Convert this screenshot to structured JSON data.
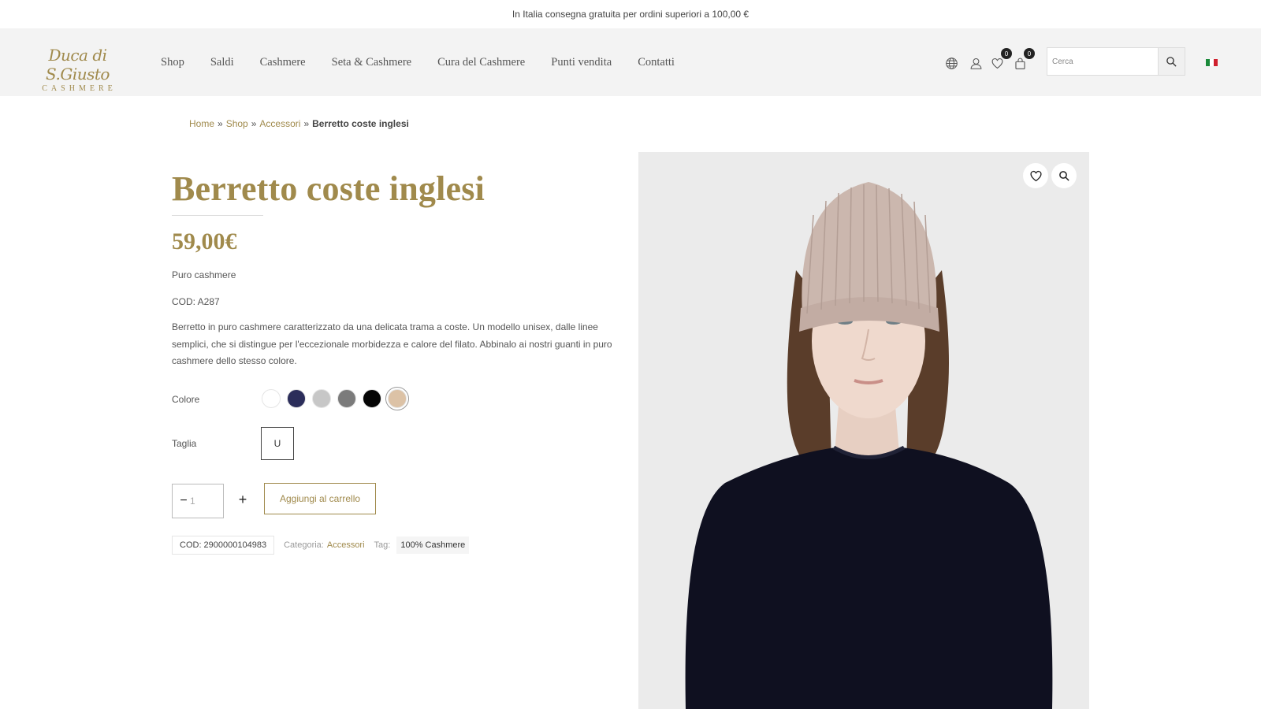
{
  "topbar": {
    "text": "In Italia consegna gratuita per ordini superiori a 100,00 €"
  },
  "header": {
    "logo": {
      "script": "Duca di S.Giusto",
      "sub": "CASHMERE"
    },
    "nav": [
      "Shop",
      "Saldi",
      "Cashmere",
      "Seta & Cashmere",
      "Cura del Cashmere",
      "Punti vendita",
      "Contatti"
    ],
    "wishlist_count": "0",
    "cart_count": "0",
    "search": {
      "placeholder": "Cerca"
    },
    "language_flag": "italian-flag"
  },
  "breadcrumb": {
    "home": "Home",
    "shop": "Shop",
    "category": "Accessori",
    "sep": "»",
    "current": "Berretto coste inglesi"
  },
  "product": {
    "title": "Berretto coste inglesi",
    "price": "59,00€",
    "material": "Puro cashmere",
    "code": "COD: A287",
    "description": "Berretto in puro cashmere caratterizzato da una delicata trama a coste. Un modello unisex, dalle linee semplici, che si distingue per l'eccezionale morbidezza e calore del filato. Abbinalo ai nostri guanti in puro cashmere dello stesso colore.",
    "color_label": "Colore",
    "colors": [
      "#ffffff",
      "#2b2d5a",
      "#c7c7c7",
      "#7b7b7b",
      "#050505",
      "#dcc2a6"
    ],
    "selected_color_index": 5,
    "size_label": "Taglia",
    "size": "U",
    "quantity": "1",
    "add_to_cart": "Aggiungi al carrello",
    "sku": "COD: 2900000104983",
    "category_label": "Categoria:",
    "category": "Accessori",
    "tag_label": "Tag:",
    "tag": "100% Cashmere"
  },
  "colors": {
    "accent": "#a08a4c",
    "header_bg": "#f3f3f3"
  },
  "icons": {
    "globe": "globe-icon",
    "account": "user-icon",
    "wishlist": "heart-icon",
    "cart": "bag-icon",
    "search": "search-icon",
    "zoom": "zoom-icon"
  }
}
